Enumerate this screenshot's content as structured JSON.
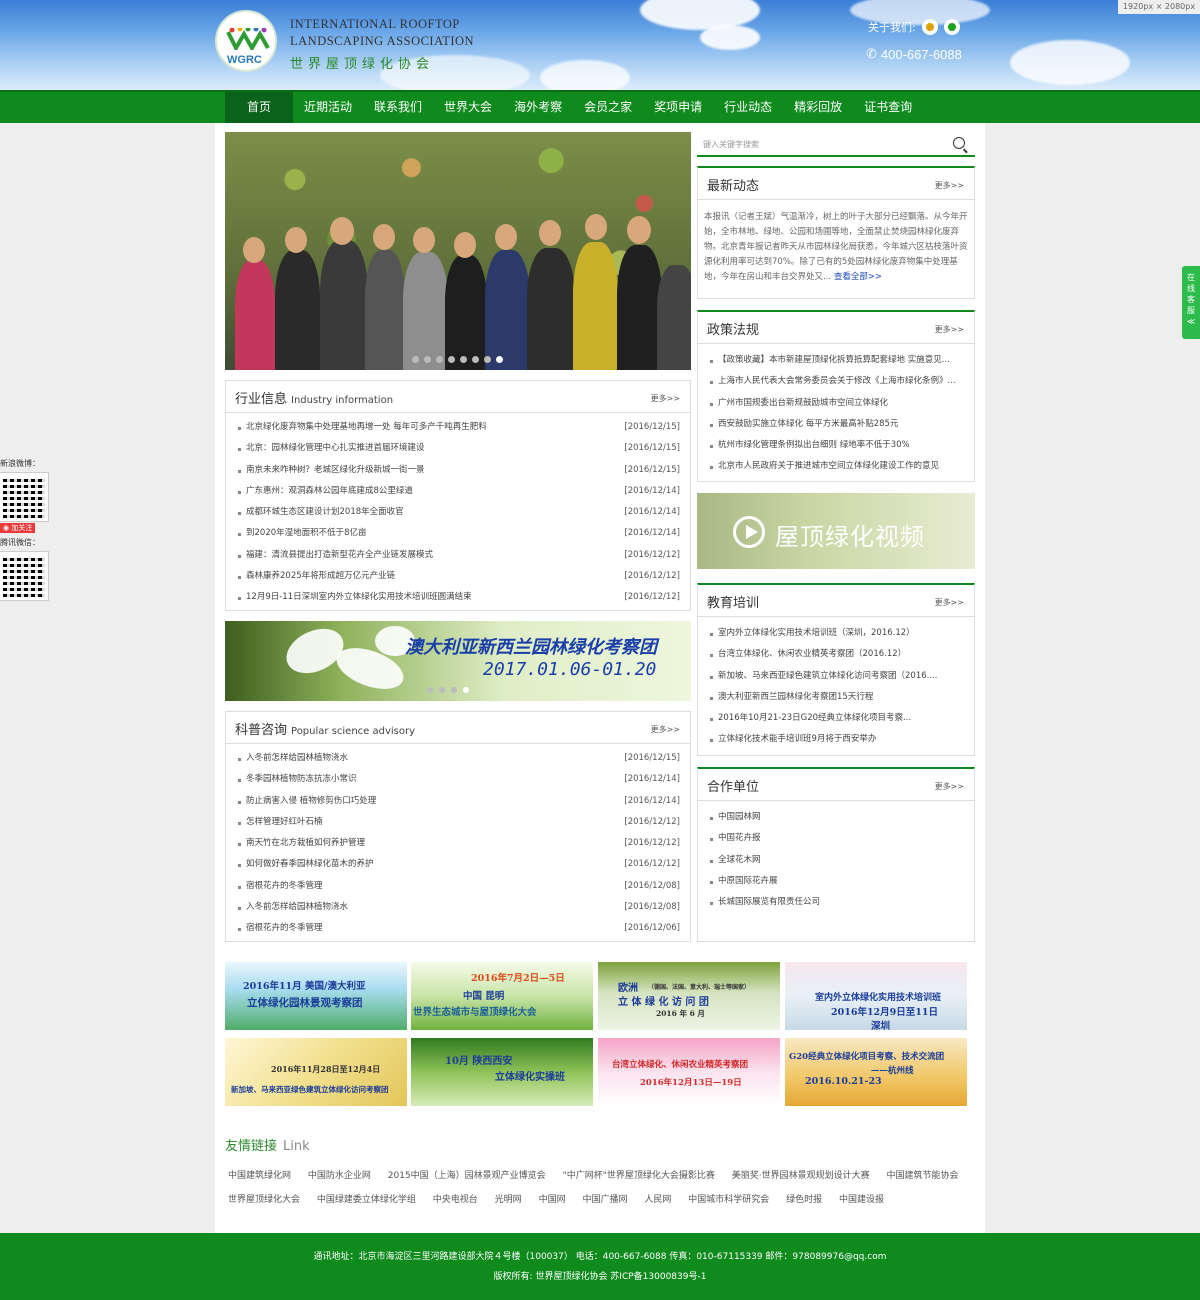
{
  "header": {
    "size_chip": "1920px × 2080px",
    "logo_abbr": "WGRC",
    "logo_en_line1": "INTERNATIONAL ROOFTOP",
    "logo_en_line2": "LANDSCAPING ASSOCIATION",
    "logo_cn": "世界屋顶绿化协会",
    "about_label": "关于我们:",
    "phone": "400-667-6088",
    "icons": [
      "weibo-icon",
      "wechat-icon",
      "phone-icon"
    ]
  },
  "nav": [
    "首页",
    "近期活动",
    "联系我们",
    "世界大会",
    "海外考察",
    "会员之家",
    "奖项申请",
    "行业动态",
    "精彩回放",
    "证书查询"
  ],
  "search": {
    "placeholder": "键入关键字搜索"
  },
  "more_label": "更多>>",
  "latest": {
    "title": "最新动态",
    "text": "本报讯（记者王斌）气温渐冷，树上的叶子大部分已经飘落。从今年开始，全市林地、绿地、公园和场圃等地，全面禁止焚烧园林绿化废弃物。北京青年报记者昨天从市园林绿化局获悉，今年城六区枯枝落叶资源化利用率可达到70%。除了已有的5处园林绿化废弃物集中处理基地，今年在房山和丰台交界处又...",
    "all_link": "查看全部>>"
  },
  "industry": {
    "title": "行业信息",
    "subtitle": "Industry information",
    "items": [
      {
        "text": "北京绿化废弃物集中处理基地再增一处 每年可多产千吨再生肥料",
        "date": "[2016/12/15]"
      },
      {
        "text": "北京：园林绿化管理中心扎实推进首届环境建设",
        "date": "[2016/12/15]"
      },
      {
        "text": "南京未来咋种树？老城区绿化升级新城一街一景",
        "date": "[2016/12/15]"
      },
      {
        "text": "广东惠州：观洞森林公园年底建成8公里绿道",
        "date": "[2016/12/14]"
      },
      {
        "text": "成都环城生态区建设计划2018年全面收官",
        "date": "[2016/12/14]"
      },
      {
        "text": "到2020年湿地面积不低于8亿亩",
        "date": "[2016/12/14]"
      },
      {
        "text": "福建：清流县提出打造新型花卉全产业链发展模式",
        "date": "[2016/12/12]"
      },
      {
        "text": "森林康养2025年将形成超万亿元产业链",
        "date": "[2016/12/12]"
      },
      {
        "text": "12月9日-11日深圳室内外立体绿化实用技术培训班圆满结束",
        "date": "[2016/12/12]"
      }
    ]
  },
  "policy": {
    "title": "政策法规",
    "items": [
      "【政策收藏】本市新建屋顶绿化拆算抵算配套绿地 实施意见...",
      "上海市人民代表大会常务委员会关于修改《上海市绿化条例》...",
      "广州市国规委出台新规鼓励城市空间立体绿化",
      "西安鼓励实施立体绿化 每平方米最高补贴285元",
      "杭州市绿化管理条例拟出台细则 绿地率不低于30%",
      "北京市人民政府关于推进城市空间立体绿化建设工作的意见"
    ]
  },
  "banner": {
    "line1": "澳大利亚新西兰园林绿化考察团",
    "line2": "2017.01.06-01.20"
  },
  "video_label": "屋顶绿化视频",
  "science": {
    "title": "科普咨询",
    "subtitle": "Popular science advisory",
    "items": [
      {
        "text": "入冬前怎样给园林植物浇水",
        "date": "[2016/12/15]"
      },
      {
        "text": "冬季园林植物防冻抗冻小常识",
        "date": "[2016/12/14]"
      },
      {
        "text": "防止病害入侵 植物修剪伤口巧处理",
        "date": "[2016/12/14]"
      },
      {
        "text": "怎样管理好红叶石楠",
        "date": "[2016/12/12]"
      },
      {
        "text": "南天竹在北方栽植如何养护管理",
        "date": "[2016/12/12]"
      },
      {
        "text": "如何做好春季园林绿化苗木的养护",
        "date": "[2016/12/12]"
      },
      {
        "text": "宿根花卉的冬季管理",
        "date": "[2016/12/08]"
      },
      {
        "text": "入冬前怎样给园林植物浇水",
        "date": "[2016/12/08]"
      },
      {
        "text": "宿根花卉的冬季管理",
        "date": "[2016/12/06]"
      }
    ]
  },
  "education": {
    "title": "教育培训",
    "items": [
      "室内外立体绿化实用技术培训班（深圳，2016.12）",
      "台湾立体绿化、休闲农业精英考察团（2016.12）",
      "新加坡、马来西亚绿色建筑立体绿化访问考察团（2016....",
      "澳大利亚新西兰园林绿化考察团15天行程",
      "2016年10月21-23日G20经典立体绿化项目考察...",
      "立体绿化技术能手培训班9月将于西安举办"
    ]
  },
  "partners": {
    "title": "合作单位",
    "items": [
      "中国园林网",
      "中国花卉报",
      "全球花木网",
      "中原国际花卉展",
      "长城国际展览有限责任公司"
    ]
  },
  "thumbs": [
    {
      "l1": "2016年11月  美国/澳大利亚",
      "l2": "立体绿化园林景观考察团"
    },
    {
      "l1": "2016年7月2日—5日",
      "l2": "中国    昆明",
      "l3": "世界生态城市与屋顶绿化大会"
    },
    {
      "l1": "欧洲",
      "l1b": "（德国、法国、意大利、瑞士等国家）",
      "l2": "立 体 绿 化 访 问 团",
      "l3": "2016 年 6 月"
    },
    {
      "l1": "室内外立体绿化实用技术培训班",
      "l2": "2016年12月9日至11日",
      "l3": "深圳"
    },
    {
      "l1": "2016年11月28日至12月4日",
      "l2": "新加坡、马来西亚绿色建筑立体绿化访问考察团"
    },
    {
      "l1": "10月  陕西西安",
      "l2": "立体绿化实操班"
    },
    {
      "l1": "台湾立体绿化、休闲农业精英考察团",
      "l2": "2016年12月13日—19日"
    },
    {
      "l1": "G20经典立体绿化项目考察、技术交流团",
      "l2": "——杭州线",
      "l3": "2016.10.21-23"
    }
  ],
  "links": {
    "title": "友情链接",
    "title_en": "Link",
    "items": [
      "中国建筑绿化网",
      "中国防水企业网",
      "2015中国（上海）园林景观产业博览会",
      "\"中广网杯\"世界屋顶绿化大会摄影比赛",
      "美丽奖·世界园林景观规划设计大赛",
      "中国建筑节能协会",
      "世界屋顶绿化大会",
      "中国绿建委立体绿化学组",
      "中央电视台",
      "光明网",
      "中国网",
      "中国广播网",
      "人民网",
      "中国城市科学研究会",
      "绿色时报",
      "中国建设报"
    ]
  },
  "footer": {
    "line1": "通讯地址：北京市海淀区三里河路建设部大院４号楼（100037）   电话：400-667-6088   传真：010-67115339   邮件：978089976@qq.com",
    "line2": "版权所有: 世界屋顶绿化协会 苏ICP备13000839号-1"
  },
  "side": {
    "weibo_label": "新浪微博：",
    "follow": "加关注",
    "tencent_label": "腾讯微信：",
    "service": "在线客服≪"
  },
  "colors": {
    "brand_green": "#0f8b1d",
    "nav_active": "#09631a",
    "link_blue": "#1a47b8"
  }
}
